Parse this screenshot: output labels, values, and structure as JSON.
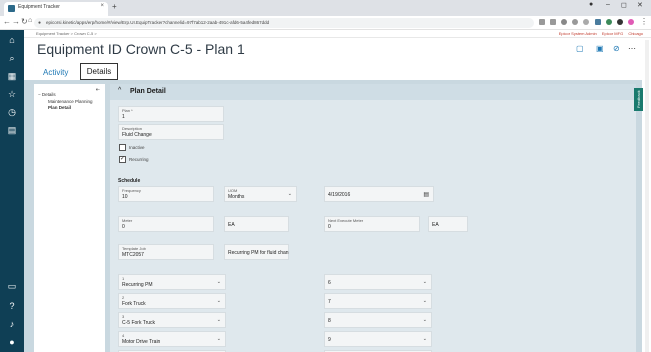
{
  "browser": {
    "tab_title": "Equipment Tracker",
    "url": "epicorsi.kinetic/apps/erp/home/#/view/Erp.UI.EquipTracker?channelid=97f7ab12-2aab-491c-afd6-5a4fed867ddd"
  },
  "app": {
    "breadcrumb": "Equipment Tracker  >  Crown C-5  >",
    "system_links": [
      "Epicor System Admin",
      "Epicor MFG",
      "Chicago"
    ],
    "page_title": "Equipment ID Crown C-5 - Plan 1",
    "tabs": {
      "activity": "Activity",
      "details": "Details"
    }
  },
  "sidebar": {
    "header": "Details",
    "items": [
      "Maintenance Planning",
      "Plan Detail"
    ]
  },
  "panel": {
    "title": "Plan Detail",
    "feedback": "Feedback",
    "plan": {
      "label": "Plan *",
      "value": "1"
    },
    "description": {
      "label": "Description",
      "value": "Fluid Change"
    },
    "inactive_label": "Inactive",
    "recurring_label": "Recurring",
    "schedule_title": "Schedule",
    "frequency": {
      "label": "Frequency",
      "value": "10"
    },
    "uom": {
      "label": "UOM",
      "value": "Months"
    },
    "date_value": "4/19/2016",
    "meter": {
      "label": "Meter",
      "value": "0"
    },
    "meter_uom": "EA",
    "next_meter": {
      "label": "Next Execute Meter",
      "value": "0"
    },
    "next_meter_uom": "EA",
    "template_job": {
      "label": "Template Job",
      "value": "MTC2057"
    },
    "template_desc": "Recurring PM for fluid chan",
    "left_drops": [
      {
        "label": "1",
        "value": "Recurring PM"
      },
      {
        "label": "2",
        "value": "Fork Truck"
      },
      {
        "label": "3",
        "value": "C-5 Fork Truck"
      },
      {
        "label": "4",
        "value": "Motor Drive Train"
      }
    ],
    "right_drops": [
      "6",
      "7",
      "8",
      "9"
    ]
  }
}
